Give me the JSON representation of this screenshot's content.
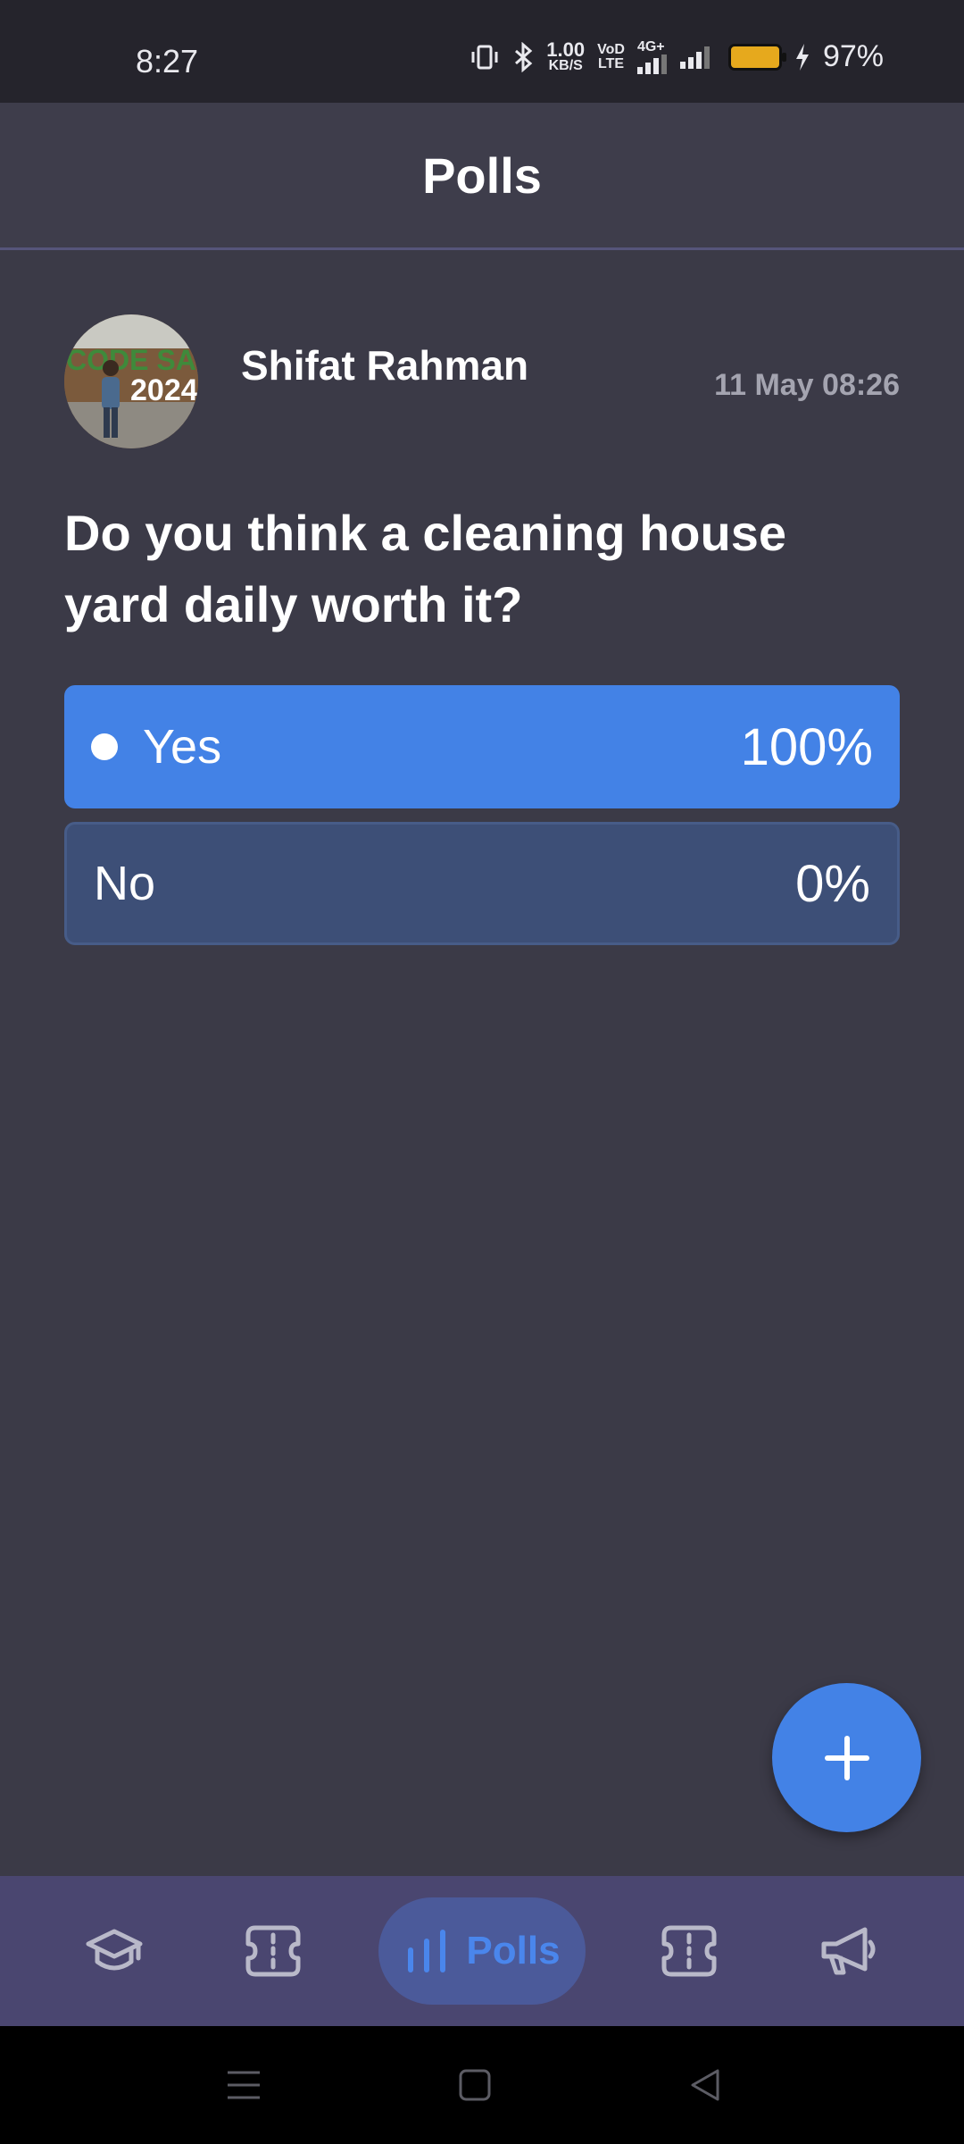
{
  "status_bar": {
    "time": "8:27",
    "speed_value": "1.00",
    "speed_unit": "KB/S",
    "volte_top": "VoD",
    "volte_bottom": "LTE",
    "network": "4G+",
    "battery_percent": "97%",
    "battery_color": "#e6a91d"
  },
  "header": {
    "title": "Polls"
  },
  "poll": {
    "author": "Shifat Rahman",
    "date": "11 May 08:26",
    "avatar_text_top": "CODE SAM",
    "avatar_text_bottom": "2024",
    "question": "Do you think a cleaning house yard daily worth it?",
    "options": [
      {
        "label": "Yes",
        "percent": "100%",
        "value": 1.0,
        "selected": true
      },
      {
        "label": "No",
        "percent": "0%",
        "value": 0.0,
        "selected": false
      }
    ]
  },
  "fab": {
    "icon": "plus-icon"
  },
  "bottom_nav": {
    "items": [
      {
        "icon": "graduation-cap-icon"
      },
      {
        "icon": "ticket-icon"
      },
      {
        "icon": "bar-chart-icon",
        "label": "Polls",
        "active": true
      },
      {
        "icon": "ticket-icon"
      },
      {
        "icon": "megaphone-icon"
      }
    ]
  },
  "system_nav": {
    "items": [
      "menu-icon",
      "home-square-icon",
      "back-triangle-icon"
    ]
  },
  "colors": {
    "background": "#3b3a47",
    "accent": "#4382e6",
    "nav_background": "#4a4670"
  }
}
